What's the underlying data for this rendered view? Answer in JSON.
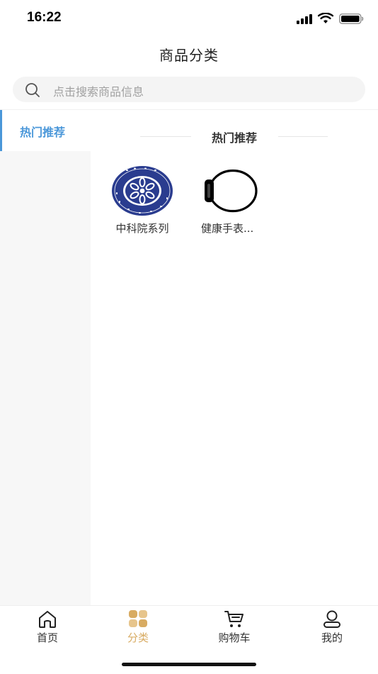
{
  "status_bar": {
    "time": "16:22"
  },
  "header": {
    "title": "商品分类"
  },
  "search": {
    "placeholder": "点击搜索商品信息"
  },
  "sidebar": {
    "items": [
      {
        "label": "热门推荐",
        "active": true
      }
    ]
  },
  "content": {
    "section_title": "热门推荐",
    "categories": [
      {
        "label": "中科院系列",
        "icon": "cas-logo-icon"
      },
      {
        "label": "健康手表...",
        "icon": "watch-icon"
      }
    ]
  },
  "tab_bar": {
    "tabs": [
      {
        "label": "首页",
        "icon": "home-icon",
        "active": false
      },
      {
        "label": "分类",
        "icon": "category-grid-icon",
        "active": true
      },
      {
        "label": "购物车",
        "icon": "cart-icon",
        "active": false
      },
      {
        "label": "我的",
        "icon": "profile-icon",
        "active": false
      }
    ]
  },
  "colors": {
    "accent_blue": "#4a97d9",
    "active_tab": "#d8ab62",
    "cas_blue": "#2a3c8f"
  }
}
